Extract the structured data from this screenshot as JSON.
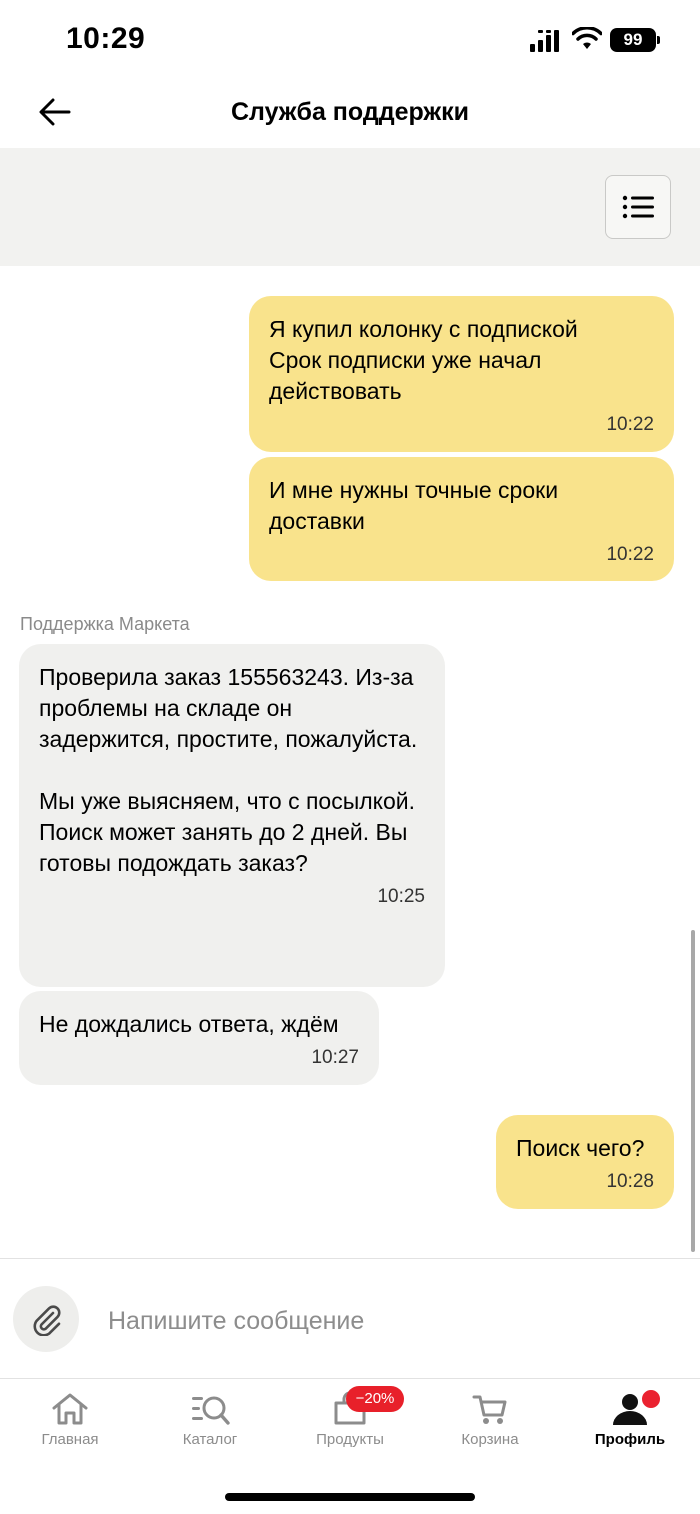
{
  "status_bar": {
    "time": "10:29",
    "battery": "99"
  },
  "header": {
    "title": "Служба поддержки"
  },
  "messages": [
    {
      "direction": "out",
      "text": "Я купил колонку с подпиской\nСрок подписки уже начал действовать",
      "time": "10:22"
    },
    {
      "direction": "out",
      "text": "И мне нужны точные сроки доставки",
      "time": "10:22"
    },
    {
      "direction": "in",
      "sender": "Поддержка Маркета",
      "text": "Проверила заказ 155563243. Из-за проблемы на складе он задержится, простите, пожалуйста.\n\nМы уже выясняем, что с посылкой. Поиск может занять до 2 дней. Вы готовы подождать заказ?",
      "time": "10:25"
    },
    {
      "direction": "in",
      "text": "Не дождались ответа, ждём",
      "time": "10:27"
    },
    {
      "direction": "out",
      "text": "Поиск чего?",
      "time": "10:28"
    }
  ],
  "composer": {
    "placeholder": "Напишите сообщение"
  },
  "tab_bar": {
    "tabs": [
      {
        "label": "Главная",
        "icon": "home-icon"
      },
      {
        "label": "Каталог",
        "icon": "catalog-search-icon"
      },
      {
        "label": "Продукты",
        "icon": "grocery-bag-icon",
        "badge": "−20%"
      },
      {
        "label": "Корзина",
        "icon": "cart-icon"
      },
      {
        "label": "Профиль",
        "icon": "profile-icon",
        "active": true
      }
    ]
  },
  "colors": {
    "outgoing_bubble": "#f9e38c",
    "incoming_bubble": "#f0f0ee",
    "badge_red": "#e8202a"
  }
}
